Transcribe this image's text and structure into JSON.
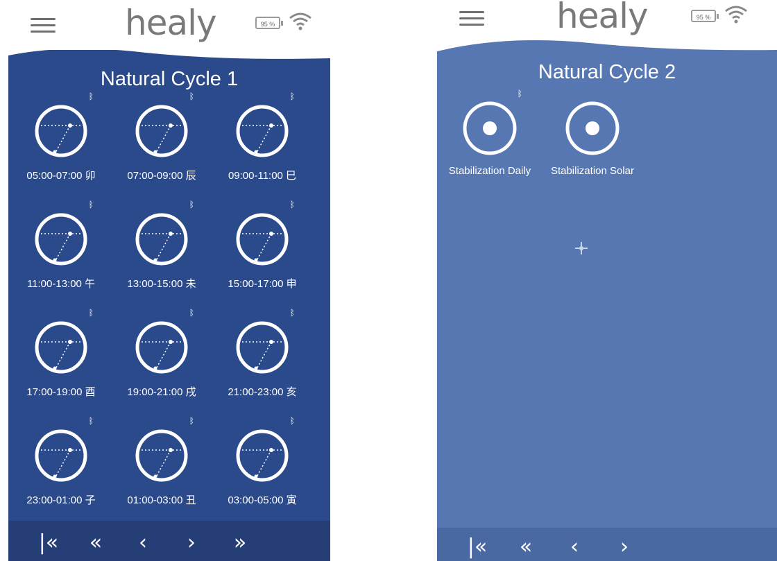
{
  "left": {
    "header": {
      "logo": "healy",
      "battery": "95 %"
    },
    "title": "Natural Cycle 1",
    "programs": [
      {
        "label": "05:00-07:00 卯"
      },
      {
        "label": "07:00-09:00 辰"
      },
      {
        "label": "09:00-11:00 巳"
      },
      {
        "label": "11:00-13:00 午"
      },
      {
        "label": "13:00-15:00 未"
      },
      {
        "label": "15:00-17:00 申"
      },
      {
        "label": "17:00-19:00 酉"
      },
      {
        "label": "19:00-21:00 戌"
      },
      {
        "label": "21:00-23:00 亥"
      },
      {
        "label": "23:00-01:00 子"
      },
      {
        "label": "01:00-03:00 丑"
      },
      {
        "label": "03:00-05:00 寅"
      }
    ],
    "nav": {
      "first": "|«",
      "prev_page": "«",
      "prev": "‹",
      "next": "›",
      "next_page": "»"
    }
  },
  "right": {
    "header": {
      "logo": "healy",
      "battery": "95 %"
    },
    "title": "Natural Cycle 2",
    "programs": [
      {
        "label": "Stabilization Daily"
      },
      {
        "label": "Stabilization Solar"
      }
    ],
    "nav": {
      "first": "|«",
      "prev_page": "«",
      "prev": "‹",
      "next": "›"
    }
  },
  "icons": {
    "menu": "hamburger-menu-icon",
    "battery": "battery-icon",
    "wifi": "wifi-icon",
    "bluetooth": "bluetooth-icon",
    "clock": "clock-icon",
    "target": "target-icon"
  },
  "colors": {
    "panel_left": "#2b4a8c",
    "panel_right": "#5677b1",
    "logo": "#7a7a7a"
  }
}
